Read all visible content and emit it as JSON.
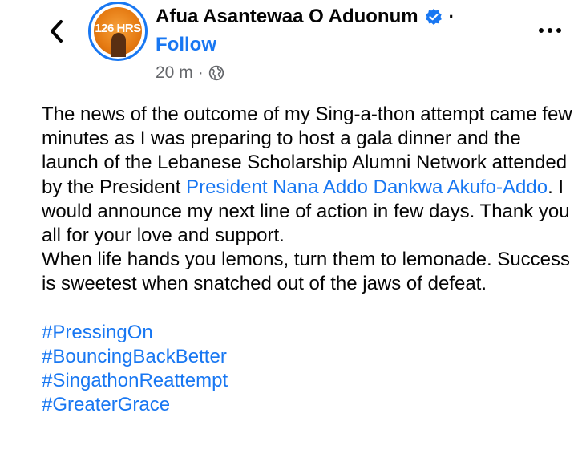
{
  "header": {
    "back_icon": "chevron-left-icon",
    "avatar": {
      "badge_text": "126 HRS"
    },
    "name": "Afua Asantewaa O Aduonum",
    "verified_icon": "verified-badge-icon",
    "separator": "·",
    "follow_label": "Follow",
    "time": "20 m",
    "meta_separator": "·",
    "audience_icon": "globe-icon",
    "more_icon": "more-horizontal-icon"
  },
  "post": {
    "para1_before": "The news of the outcome of my Sing-a-thon attempt came few minutes as I was preparing to host a gala dinner and the launch of the Lebanese Scholarship Alumni Network attended by the President ",
    "mention": "President Nana Addo Dankwa Akufo-Addo",
    "para1_after": ". I would announce my next line of action in few days. Thank you all for your love and support.",
    "para2": "When life hands you lemons, turn them to lemonade. Success is sweetest when snatched out of the jaws of defeat.",
    "hashtags": [
      "#PressingOn",
      "#BouncingBackBetter",
      "#SingathonReattempt",
      "#GreaterGrace"
    ]
  },
  "colors": {
    "link": "#1877f2",
    "text": "#050505",
    "meta": "#65676b"
  }
}
